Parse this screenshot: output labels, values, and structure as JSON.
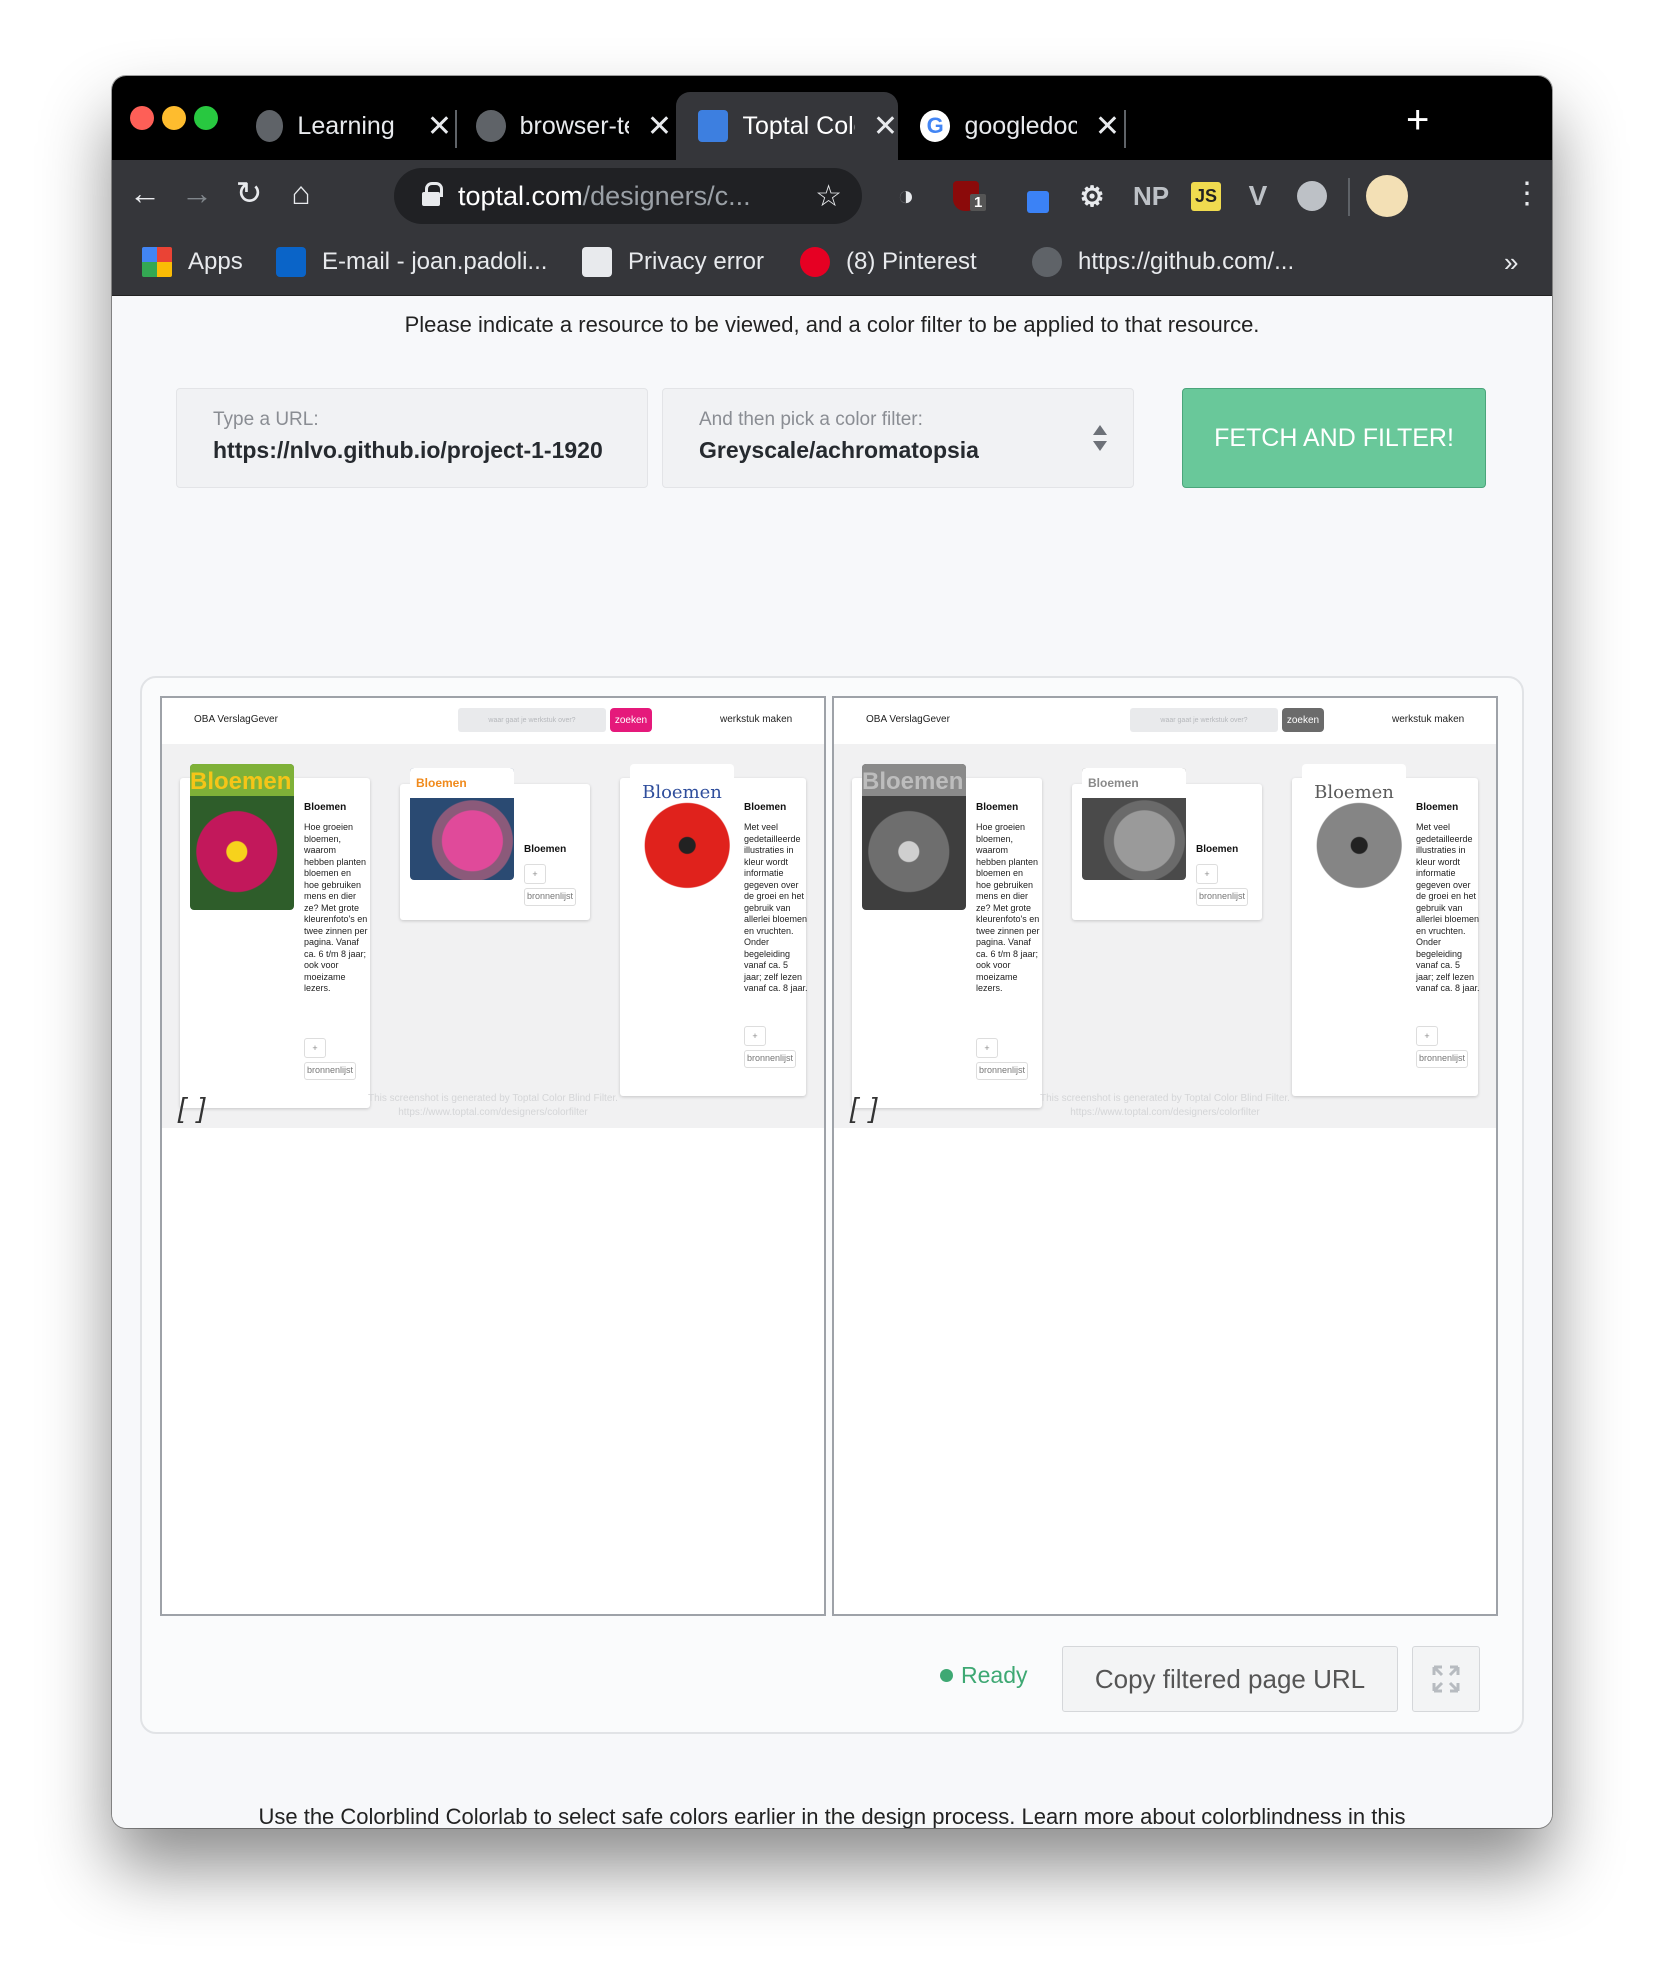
{
  "tabs": [
    {
      "title": "Learning",
      "icon": "globe-icon"
    },
    {
      "title": "browser-techn",
      "icon": "github-icon"
    },
    {
      "title": "Toptal Color B",
      "icon": "toptal-icon"
    },
    {
      "title": "googledocs -",
      "icon": "google-icon"
    }
  ],
  "toolbar": {
    "url_host": "toptal.com",
    "url_path": "/designers/c...",
    "ext_badge": "1",
    "np_label": "NP",
    "js_label": "JS"
  },
  "bookmarks": [
    {
      "label": "Apps"
    },
    {
      "label": "E-mail - joan.padoli..."
    },
    {
      "label": "Privacy error"
    },
    {
      "label": "(8) Pinterest"
    },
    {
      "label": "https://github.com/..."
    }
  ],
  "bookmarks_more": "»",
  "page": {
    "intro": "Please indicate a resource to be viewed, and a color filter to be applied to that resource.",
    "url_label": "Type a URL:",
    "url_value": "https://nlvo.github.io/project-1-1920",
    "filter_label": "And then pick a color filter:",
    "filter_value": "Greyscale/achromatopsia",
    "fetch_label": "FETCH AND FILTER!",
    "status": "Ready",
    "copy_label": "Copy filtered page URL",
    "footer": "Use the Colorblind Colorlab to select safe colors earlier in the design process. Learn more about colorblindness in this"
  },
  "preview": {
    "brand": "OBA VerslagGever",
    "search_placeholder": "waar gaat je werkstuk over?",
    "search_button": "zoeken",
    "make_label": "werkstuk maken",
    "books": [
      {
        "cover_title": "Bloemen",
        "title": "Bloemen",
        "desc": "Hoe groeien bloemen, waarom hebben planten bloemen en hoe gebruiken mens en dier ze? Met grote kleurenfoto's en twee zinnen per pagina. Vanaf ca. 6 t/m 8 jaar; ook voor moeizame lezers.",
        "add": "+",
        "source": "bronnenlijst"
      },
      {
        "cover_title": "Bloemen",
        "title": "Bloemen",
        "desc": "",
        "add": "+",
        "source": "bronnenlijst"
      },
      {
        "cover_title": "Bloemen",
        "title": "Bloemen",
        "desc": "Met veel gedetailleerde illustraties in kleur wordt informatie gegeven over de groei en het gebruik van allerlei bloemen en vruchten. Onder begeleiding vanaf ca. 5 jaar; zelf lezen vanaf ca. 8 jaar.",
        "add": "+",
        "source": "bronnenlijst"
      }
    ],
    "bracket": "[ ]",
    "watermark_1": "This screenshot is generated by Toptal Color Blind Filter.",
    "watermark_2": "https://www.toptal.com/designers/colorfilter"
  },
  "colors": {
    "accent": "#69c89a",
    "ready": "#3ea873",
    "zoeken_original": "#e5197b",
    "zoeken_filtered": "#6b6b6b"
  }
}
